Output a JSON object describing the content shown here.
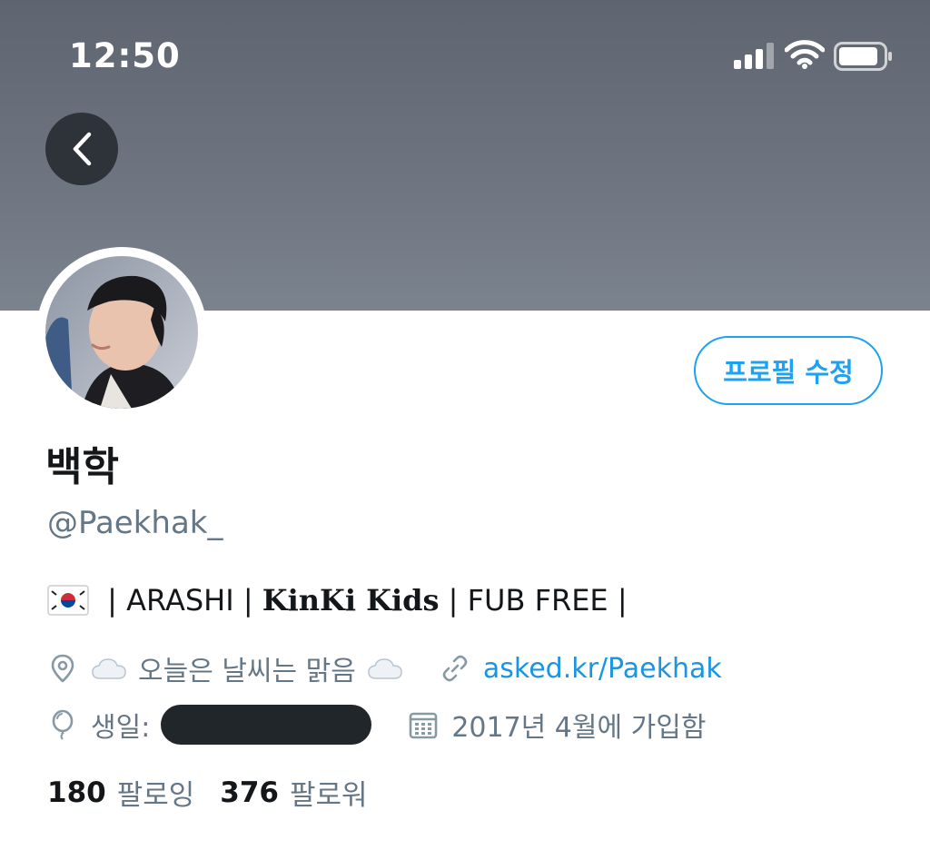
{
  "status_bar": {
    "time": "12:50",
    "icons": [
      "signal-icon",
      "wifi-icon",
      "battery-icon"
    ]
  },
  "header": {
    "back_icon": "chevron-left-icon",
    "banner_color": "#6d747f"
  },
  "profile": {
    "edit_button_label": "프로필 수정",
    "display_name": "백학",
    "handle": "@Paekhak_",
    "bio": {
      "flag_icon": "south-korea-flag-icon",
      "part1": " | ARASHI | ",
      "part2": "KinKi Kids",
      "part3": " | FUB FREE |"
    },
    "location": "오늘은 날씨는 맑음",
    "link": "asked.kr/Paekhak",
    "birthday_label": "생일:",
    "joined": "2017년 4월에 가입함"
  },
  "stats": {
    "following_count": "180",
    "following_label": "팔로잉",
    "followers_count": "376",
    "followers_label": "팔로워"
  },
  "colors": {
    "accent": "#1da1f2",
    "link": "#1b95e0",
    "secondary_text": "#657786",
    "primary_text": "#14171a"
  }
}
